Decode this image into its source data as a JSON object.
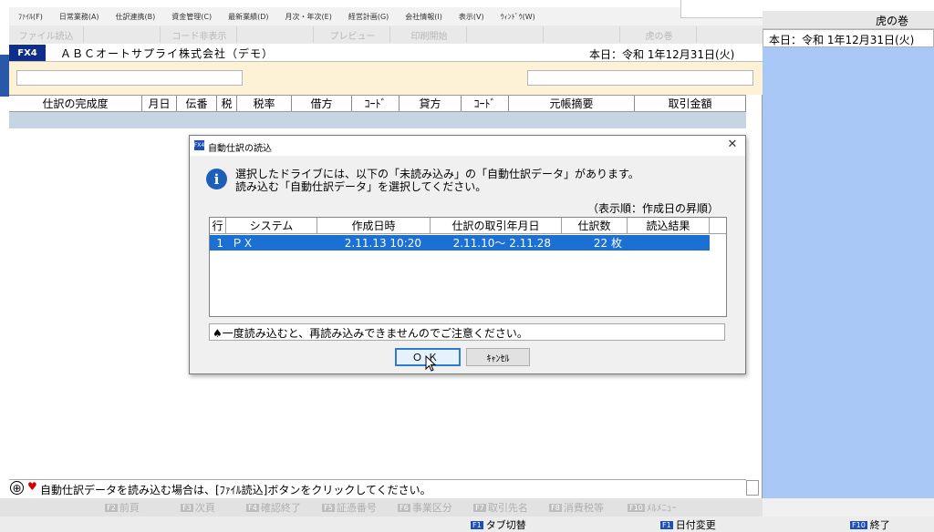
{
  "colors": {
    "brand_navy": "#0f2e8a",
    "selection_blue": "#1c6fd3",
    "right_panel_blue": "#a9c8f6",
    "filter_bar_cream": "#fdf1d6",
    "heart_red": "#d00000"
  },
  "menu": [
    "ﾌｧｲﾙ(F)",
    "日常業務(A)",
    "仕訳連携(B)",
    "資金管理(C)",
    "最新業績(D)",
    "月次・年次(E)",
    "経営計画(G)",
    "会社情報(I)",
    "表示(V)",
    "ｳｨﾝﾄﾞｳ(W)"
  ],
  "toolbar": [
    "ファイル読込",
    "",
    "コード非表示",
    "",
    "プレビュー",
    "印刷開始",
    "",
    "",
    "虎の巻"
  ],
  "company": {
    "badge": "FX4",
    "name": "ＡＢＣオートサプライ株式会社（デモ）",
    "today": "本日：令和 1年12月31日(火)"
  },
  "grid": {
    "columns": [
      "仕訳の完成度",
      "月日",
      "伝番",
      "税",
      "税率",
      "借方",
      "ｺｰﾄﾞ",
      "貸方",
      "ｺｰﾄﾞ",
      "元帳摘要",
      "取引金額"
    ]
  },
  "right_panel": {
    "tora_label": "虎の巻",
    "date": "本日：令和 1年12月31日(火)"
  },
  "dialog": {
    "app_icon": "FX4",
    "title": "自動仕訳の読込",
    "message_line1": "選択したドライブには、以下の「未読み込み」の「自動仕訳データ」があります。",
    "message_line2": "読み込む「自動仕訳データ」を選択してください。",
    "sort_note": "（表示順：作成日の昇順）",
    "list_columns": [
      "行",
      "システム",
      "作成日時",
      "仕訳の取引年月日",
      "仕訳数",
      "読込結果"
    ],
    "rows": [
      {
        "line": "1",
        "system": "ＰＸ",
        "created": "2.11.13 10:20",
        "range": "2.11.10～ 2.11.28",
        "count": "22 枚",
        "result": ""
      }
    ],
    "note": "♠一度読み込むと、再読み込みできませんのでご注意ください。",
    "ok_label": "ＯＫ",
    "cancel_label": "ｷｬﾝｾﾙ"
  },
  "status": {
    "text": "自動仕訳データを読み込む場合は、[ﾌｧｲﾙ読込]ボタンをクリックしてください。"
  },
  "fkeys": [
    {
      "key": "F2",
      "label": "前頁"
    },
    {
      "key": "F3",
      "label": "次頁"
    },
    {
      "key": "F4",
      "label": "確認終了"
    },
    {
      "key": "F5",
      "label": "証憑番号"
    },
    {
      "key": "F6",
      "label": "事業区分"
    },
    {
      "key": "F7",
      "label": "取引先名"
    },
    {
      "key": "F8",
      "label": "消費税等"
    },
    {
      "key": "F10",
      "label": "ﾒﾙﾒﾆｭｰ"
    }
  ],
  "bottom": {
    "tab_key": "F1",
    "tab_label": "タブ切替",
    "date_key": "F1",
    "date_label": "日付変更",
    "end_key": "F10",
    "end_label": "終了"
  }
}
